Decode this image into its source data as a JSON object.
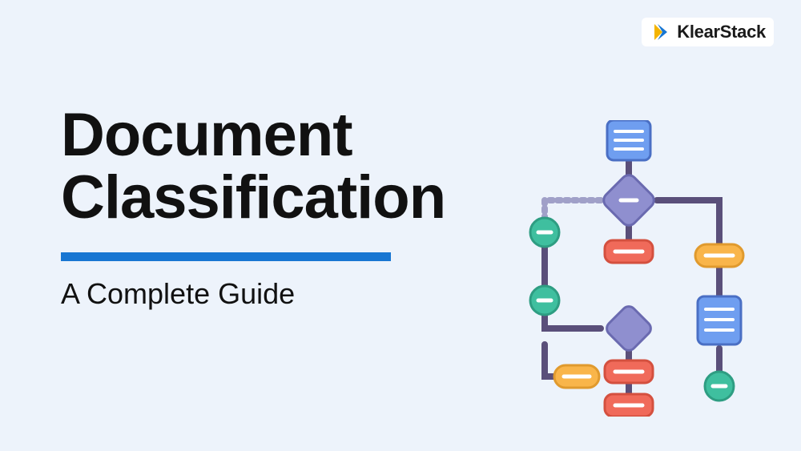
{
  "brand": {
    "name": "KlearStack",
    "icon": "chevron-star-icon",
    "colors": {
      "primary_blue": "#1876d2",
      "accent_yellow": "#f4b400"
    }
  },
  "title_line1": "Document",
  "title_line2": "Classification",
  "subtitle": "A Complete Guide",
  "illustration": {
    "type": "flowchart",
    "description": "Decision flowchart with document nodes, diamond decisions, pill terminals, and circular minus connectors",
    "colors": {
      "document": "#6f9ef0",
      "diamond": "#8f8fcf",
      "terminal_red": "#f06a5a",
      "terminal_yellow": "#f9b54a",
      "circle": "#3fbf9f",
      "connector": "#5a4f7a"
    }
  },
  "background": "#edf3fb"
}
